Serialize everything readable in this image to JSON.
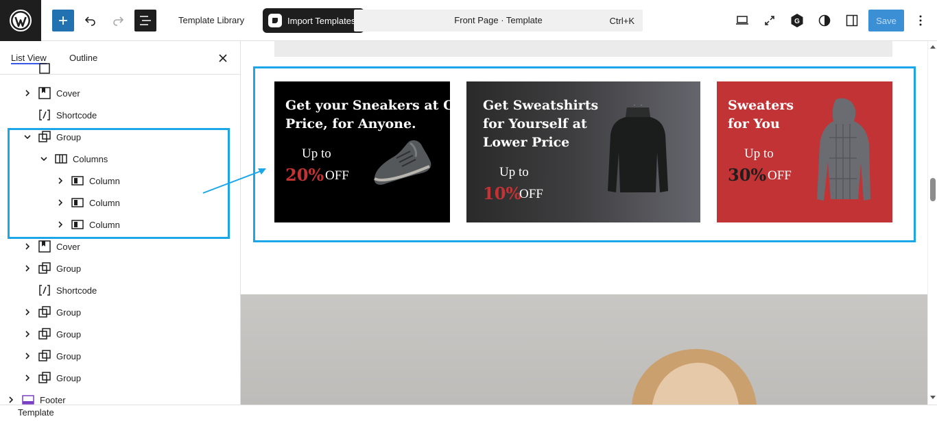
{
  "topbar": {
    "template_library_label": "Template Library",
    "import_templates_label": "Import Templates",
    "command_title": "Front Page · Template",
    "command_shortcut": "Ctrl+K",
    "save_label": "Save"
  },
  "sidebar": {
    "tabs": [
      {
        "label": "List View",
        "active": true
      },
      {
        "label": "Outline",
        "active": false
      }
    ],
    "tree": [
      {
        "label": "Cover",
        "icon": "cover-icon",
        "level": 1,
        "expanded": false
      },
      {
        "label": "Shortcode",
        "icon": "shortcode-icon",
        "level": 1,
        "expanded": null
      },
      {
        "label": "Group",
        "icon": "group-icon",
        "level": 1,
        "expanded": true
      },
      {
        "label": "Columns",
        "icon": "columns-icon",
        "level": 2,
        "expanded": true
      },
      {
        "label": "Column",
        "icon": "column-icon",
        "level": 3,
        "expanded": false
      },
      {
        "label": "Column",
        "icon": "column-icon",
        "level": 3,
        "expanded": false
      },
      {
        "label": "Column",
        "icon": "column-icon",
        "level": 3,
        "expanded": false
      },
      {
        "label": "Cover",
        "icon": "cover-icon",
        "level": 1,
        "expanded": false
      },
      {
        "label": "Group",
        "icon": "group-icon",
        "level": 1,
        "expanded": false
      },
      {
        "label": "Shortcode",
        "icon": "shortcode-icon",
        "level": 1,
        "expanded": null
      },
      {
        "label": "Group",
        "icon": "group-icon",
        "level": 1,
        "expanded": false
      },
      {
        "label": "Group",
        "icon": "group-icon",
        "level": 1,
        "expanded": false
      },
      {
        "label": "Group",
        "icon": "group-icon",
        "level": 1,
        "expanded": false
      },
      {
        "label": "Group",
        "icon": "group-icon",
        "level": 1,
        "expanded": false
      },
      {
        "label": "Footer",
        "icon": "footer-icon",
        "level": 0,
        "expanded": false
      }
    ]
  },
  "canvas": {
    "cards": [
      {
        "title": "Get your Sneakers at Offer Price, for Anyone.",
        "up_to": "Up to",
        "percent": "20%",
        "off": "OFF",
        "percent_color": "#c23335"
      },
      {
        "title": "Get Sweatshirts for Yourself at Lower Price",
        "up_to": "Up to",
        "percent": "10%",
        "off": "OFF",
        "percent_color": "#c23335"
      },
      {
        "title": "Sweaters for You",
        "up_to": "Up to",
        "percent": "30%",
        "off": "OFF",
        "percent_color": "#1e1e1e"
      }
    ]
  },
  "status": {
    "breadcrumb": "Template"
  },
  "colors": {
    "accent": "#2271b1",
    "highlight": "#1aa6e8",
    "card3_bg": "#c23335"
  }
}
